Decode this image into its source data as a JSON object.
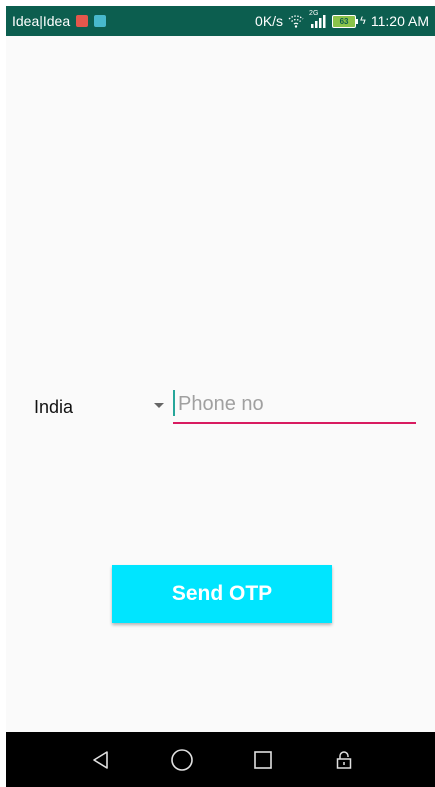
{
  "status_bar": {
    "carrier": "Idea|Idea",
    "net_speed": "0K/s",
    "network_type": "2G",
    "battery_level": "63",
    "time": "11:20 AM",
    "icons": [
      "notification-red-icon",
      "notification-teal-icon",
      "wifi-icon",
      "signal-icon",
      "battery-icon",
      "charging-bolt-icon"
    ]
  },
  "form": {
    "country": {
      "selected": "India"
    },
    "phone": {
      "value": "",
      "placeholder": "Phone no"
    },
    "send_button_label": "Send OTP"
  },
  "nav_bar": {
    "icons": [
      "back-icon",
      "home-icon",
      "recents-icon",
      "lock-icon"
    ]
  },
  "colors": {
    "status_bar_bg": "#0c5e4f",
    "accent_underline": "#d81b60",
    "button_bg": "#00e5ff",
    "cursor": "#26a69a",
    "background": "#fafafa"
  }
}
